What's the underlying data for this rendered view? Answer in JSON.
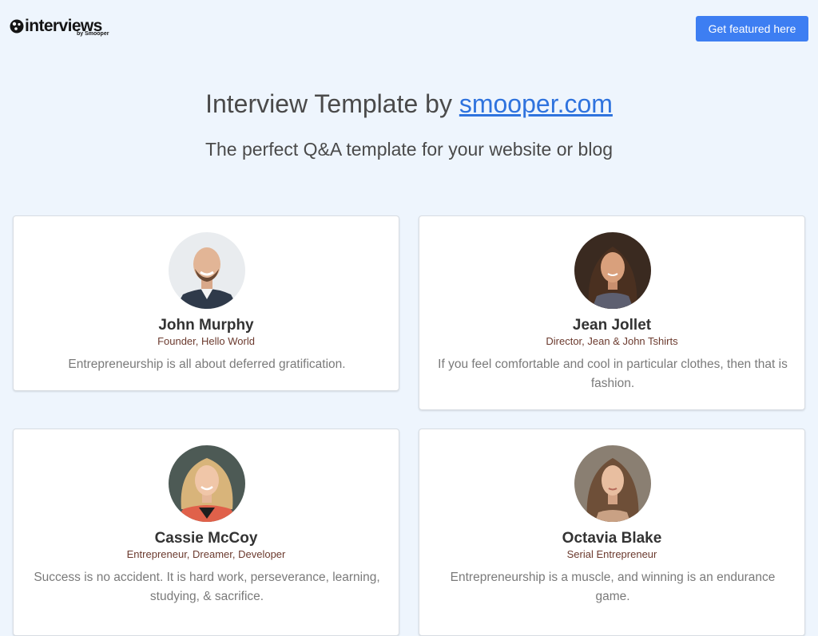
{
  "header": {
    "logo_text": "interviews",
    "logo_byline": "by Smooper",
    "cta_label": "Get featured here"
  },
  "hero": {
    "title_prefix": "Interview Template by ",
    "title_link": "smooper.com",
    "subtitle": "The perfect Q&A template for your website or blog"
  },
  "cards": [
    {
      "name": "John Murphy",
      "role": "Founder, Hello World",
      "quote": "Entrepreneurship is all about deferred gratification."
    },
    {
      "name": "Jean Jollet",
      "role": "Director, Jean & John Tshirts",
      "quote": "If you feel comfortable and cool in particular clothes, then that is fashion."
    },
    {
      "name": "Cassie McCoy",
      "role": "Entrepreneur, Dreamer, Developer",
      "quote": "Success is no accident. It is hard work, perseverance, learning, studying, & sacrifice."
    },
    {
      "name": "Octavia Blake",
      "role": "Serial Entrepreneur",
      "quote": "Entrepreneurship is a muscle, and winning is an endurance game."
    }
  ],
  "colors": {
    "page_background": "#eef5fd",
    "accent_button": "#3d7ef2",
    "link": "#2f73de",
    "role_text": "#6b3a2e"
  }
}
